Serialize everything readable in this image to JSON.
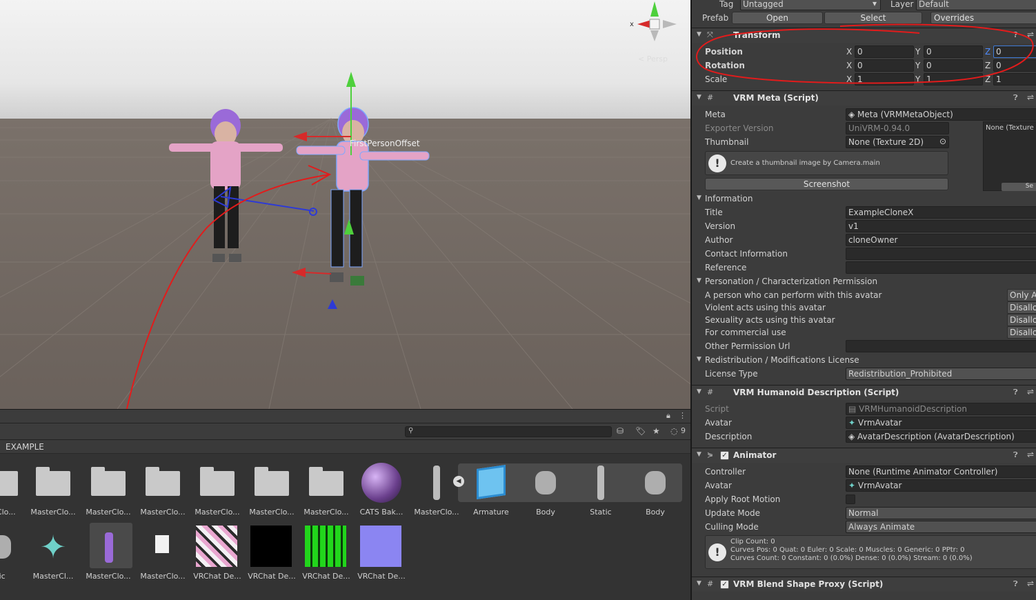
{
  "scene": {
    "label_first_person_offset": "FirstPersonOffset",
    "gizmo_x_label": "x",
    "gizmo_persp_label": "< Persp"
  },
  "project": {
    "path": "EXAMPLE",
    "filter_count": "9",
    "row1": [
      {
        "label": "terClo...",
        "kind": "folder"
      },
      {
        "label": "MasterClo...",
        "kind": "folder"
      },
      {
        "label": "MasterClo...",
        "kind": "folder"
      },
      {
        "label": "MasterClo...",
        "kind": "folder"
      },
      {
        "label": "MasterClo...",
        "kind": "folder"
      },
      {
        "label": "MasterClo...",
        "kind": "folder"
      },
      {
        "label": "MasterClo...",
        "kind": "folder"
      },
      {
        "label": "CATS Bak...",
        "kind": "material-sphere"
      },
      {
        "label": "MasterClo...",
        "kind": "model"
      },
      {
        "label": "Armature",
        "kind": "prefab-box"
      },
      {
        "label": "Body",
        "kind": "mesh"
      },
      {
        "label": "Static",
        "kind": "model"
      },
      {
        "label": "Body",
        "kind": "mesh"
      }
    ],
    "row2": [
      {
        "label": "tic",
        "kind": "mesh"
      },
      {
        "label": "MasterCl...",
        "kind": "avatar"
      },
      {
        "label": "MasterClo...",
        "kind": "prefab-selected"
      },
      {
        "label": "MasterClo...",
        "kind": "file"
      },
      {
        "label": "VRChat De...",
        "kind": "texture-pink"
      },
      {
        "label": "VRChat De...",
        "kind": "texture-black"
      },
      {
        "label": "VRChat De...",
        "kind": "texture-green"
      },
      {
        "label": "VRChat De...",
        "kind": "texture-normal"
      }
    ]
  },
  "inspector": {
    "top": {
      "tag_label": "Tag",
      "tag_value": "Untagged",
      "layer_label": "Layer",
      "layer_value": "Default",
      "prefab_label": "Prefab",
      "open": "Open",
      "select": "Select",
      "overrides": "Overrides"
    },
    "transform": {
      "title": "Transform",
      "position": "Position",
      "rotation": "Rotation",
      "scale": "Scale",
      "pos": [
        "0",
        "0",
        "0"
      ],
      "rot": [
        "0",
        "0",
        "0"
      ],
      "scl": [
        "1",
        "1",
        "1"
      ],
      "axes": [
        "X",
        "Y",
        "Z"
      ]
    },
    "vrm_meta": {
      "title": "VRM Meta (Script)",
      "meta_label": "Meta",
      "meta_value": "Meta (VRMMetaObject)",
      "exporter_label": "Exporter Version",
      "exporter_value": "UniVRM-0.94.0",
      "thumbnail_label": "Thumbnail",
      "thumbnail_value": "None (Texture 2D)",
      "thumb_preview_label": "None (Texture",
      "thumb_preview_btn": "Se",
      "help": "Create a thumbnail image by Camera.main",
      "screenshot": "Screenshot",
      "information": "Information",
      "title_label": "Title",
      "title_value": "ExampleCloneX",
      "version_label": "Version",
      "version_value": "v1",
      "author_label": "Author",
      "author_value": "cloneOwner",
      "contact_label": "Contact Information",
      "reference_label": "Reference",
      "permission_header": "Personation / Characterization Permission",
      "perform_label": "A person who can perform with this avatar",
      "perform_value": "Only A",
      "violent_label": "Violent acts using this avatar",
      "violent_value": "Disallo",
      "sexual_label": "Sexuality acts using this avatar",
      "sexual_value": "Disallo",
      "commercial_label": "For commercial use",
      "commercial_value": "Disallo",
      "other_perm_label": "Other Permission Url",
      "license_header": "Redistribution / Modifications License",
      "license_type_label": "License Type",
      "license_type_value": "Redistribution_Prohibited"
    },
    "humanoid": {
      "title": "VRM Humanoid Description (Script)",
      "script_label": "Script",
      "script_value": "VRMHumanoidDescription",
      "avatar_label": "Avatar",
      "avatar_value": "VrmAvatar",
      "desc_label": "Description",
      "desc_value": "AvatarDescription (AvatarDescription)"
    },
    "animator": {
      "title": "Animator",
      "controller_label": "Controller",
      "controller_value": "None (Runtime Animator Controller)",
      "avatar_label": "Avatar",
      "avatar_value": "VrmAvatar",
      "root_motion_label": "Apply Root Motion",
      "update_label": "Update Mode",
      "update_value": "Normal",
      "culling_label": "Culling Mode",
      "culling_value": "Always Animate",
      "clip_line1": "Clip Count: 0",
      "clip_line2": "Curves Pos: 0 Quat: 0 Euler: 0 Scale: 0 Muscles: 0 Generic: 0 PPtr: 0",
      "clip_line3": "Curves Count: 0 Constant: 0 (0.0%) Dense: 0 (0.0%) Stream: 0 (0.0%)"
    },
    "blendshape": {
      "title": "VRM Blend Shape Proxy (Script)"
    }
  },
  "colors": {
    "inspector_bg": "#3c3c3c",
    "field_bg": "#2a2a2a",
    "annotation_red": "#e31b1b",
    "gizmo_green": "#4ed03c",
    "gizmo_red": "#d62a2a",
    "gizmo_blue": "#2d3ad6"
  }
}
